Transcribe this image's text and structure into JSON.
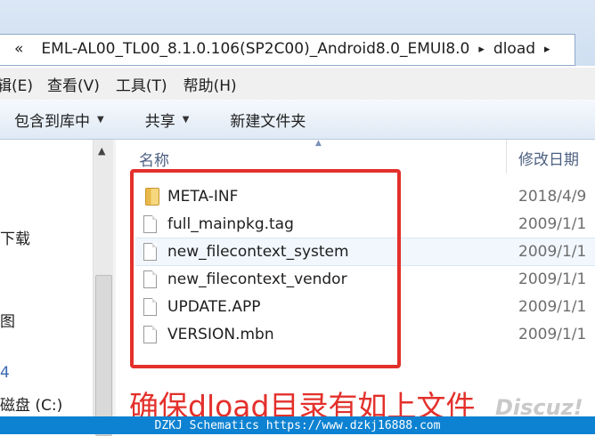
{
  "address": {
    "breadcrumb_sep": "«",
    "segments": [
      "EML-AL00_TL00_8.1.0.106(SP2C00)_Android8.0_EMUI8.0",
      "dload"
    ],
    "chevron": "▸"
  },
  "menu": [
    "辑(E)",
    "查看(V)",
    "工具(T)",
    "帮助(H)"
  ],
  "toolbar": {
    "include_library": "包含到库中",
    "share": "共享",
    "new_folder": "新建文件夹"
  },
  "nav": {
    "items": [
      "下载",
      "图",
      "4",
      "磁盘 (C:)"
    ]
  },
  "columns": {
    "name": "名称",
    "date_modified": "修改日期"
  },
  "files": [
    {
      "name": "META-INF",
      "date": "2018/4/9",
      "icon": "folder-icon"
    },
    {
      "name": "full_mainpkg.tag",
      "date": "2009/1/1",
      "icon": "file-icon"
    },
    {
      "name": "new_filecontext_system",
      "date": "2009/1/1",
      "icon": "file-icon"
    },
    {
      "name": "new_filecontext_vendor",
      "date": "2009/1/1",
      "icon": "file-icon"
    },
    {
      "name": "UPDATE.APP",
      "date": "2009/1/1",
      "icon": "file-icon"
    },
    {
      "name": "VERSION.mbn",
      "date": "2009/1/1",
      "icon": "file-icon"
    }
  ],
  "annotation": "确保dload目录有如上文件",
  "watermark": "Discuz!",
  "footer": "DZKJ Schematics https://www.dzkj16888.com",
  "colors": {
    "highlight": "#e3302b",
    "footer_bg": "#0d82d2"
  }
}
